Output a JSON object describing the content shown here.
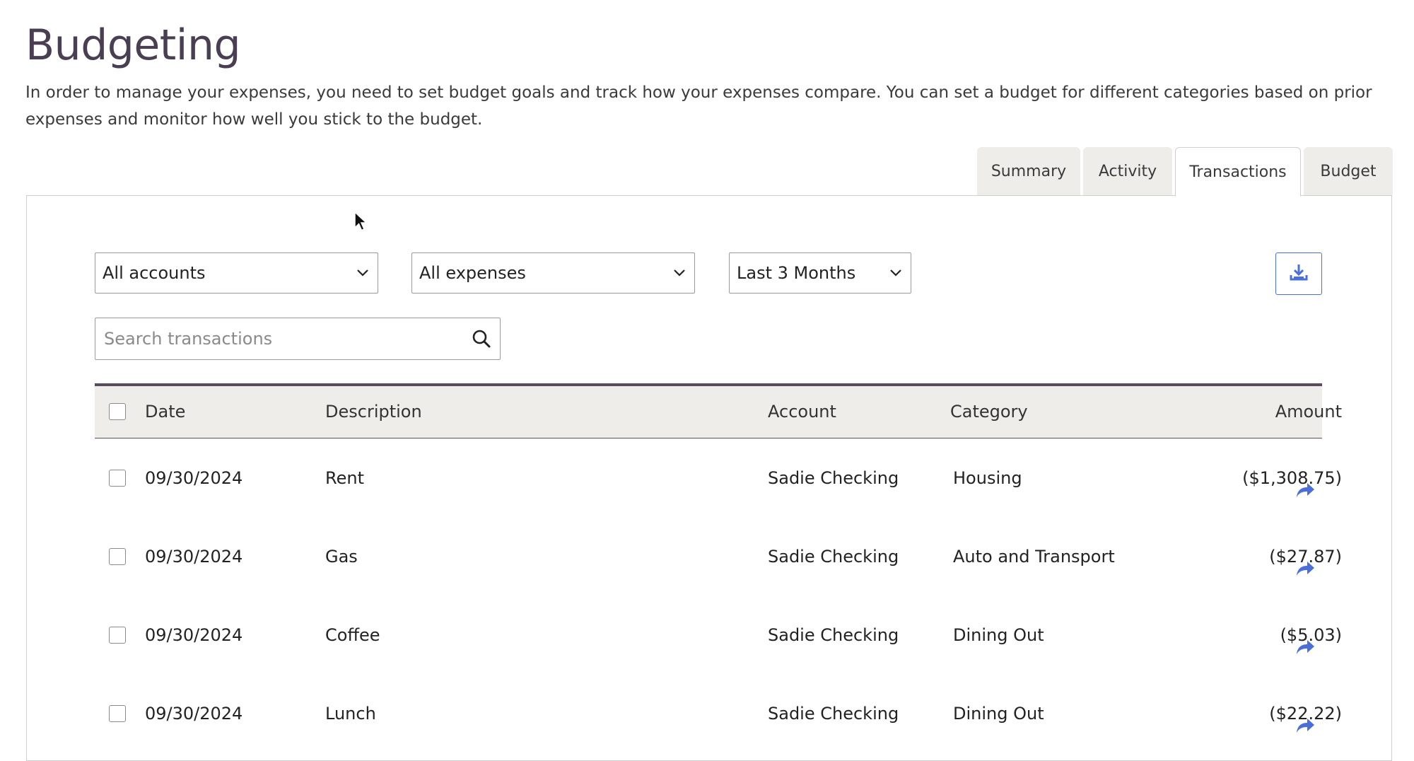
{
  "page": {
    "title": "Budgeting",
    "intro": "In order to manage your expenses, you need to set budget goals and track how your expenses compare. You can set a budget for different categories based on prior expenses and monitor how well you stick to the budget."
  },
  "tabs": [
    {
      "label": "Summary",
      "active": false
    },
    {
      "label": "Activity",
      "active": false
    },
    {
      "label": "Transactions",
      "active": true
    },
    {
      "label": "Budget",
      "active": false
    }
  ],
  "filters": {
    "accounts": {
      "value": "All accounts"
    },
    "expenses": {
      "value": "All expenses"
    },
    "period": {
      "value": "Last 3 Months"
    }
  },
  "search": {
    "placeholder": "Search transactions",
    "value": ""
  },
  "table": {
    "headers": {
      "date": "Date",
      "description": "Description",
      "account": "Account",
      "category": "Category",
      "amount": "Amount"
    },
    "rows": [
      {
        "date": "09/30/2024",
        "description": "Rent",
        "account": "Sadie Checking",
        "category": "Housing",
        "amount": "($1,308.75)"
      },
      {
        "date": "09/30/2024",
        "description": "Gas",
        "account": "Sadie Checking",
        "category": "Auto and Transport",
        "amount": "($27.87)"
      },
      {
        "date": "09/30/2024",
        "description": "Coffee",
        "account": "Sadie Checking",
        "category": "Dining Out",
        "amount": "($5.03)"
      },
      {
        "date": "09/30/2024",
        "description": "Lunch",
        "account": "Sadie Checking",
        "category": "Dining Out",
        "amount": "($22.22)"
      }
    ]
  },
  "icons": {
    "chevron": "chevron-down-icon",
    "download": "download-icon",
    "search": "search-icon",
    "share": "share-arrow-icon"
  },
  "colors": {
    "title": "#4a3f52",
    "accent": "#4a6fd8",
    "table_header_bg": "#efede9",
    "table_header_border": "#5a4a60"
  }
}
